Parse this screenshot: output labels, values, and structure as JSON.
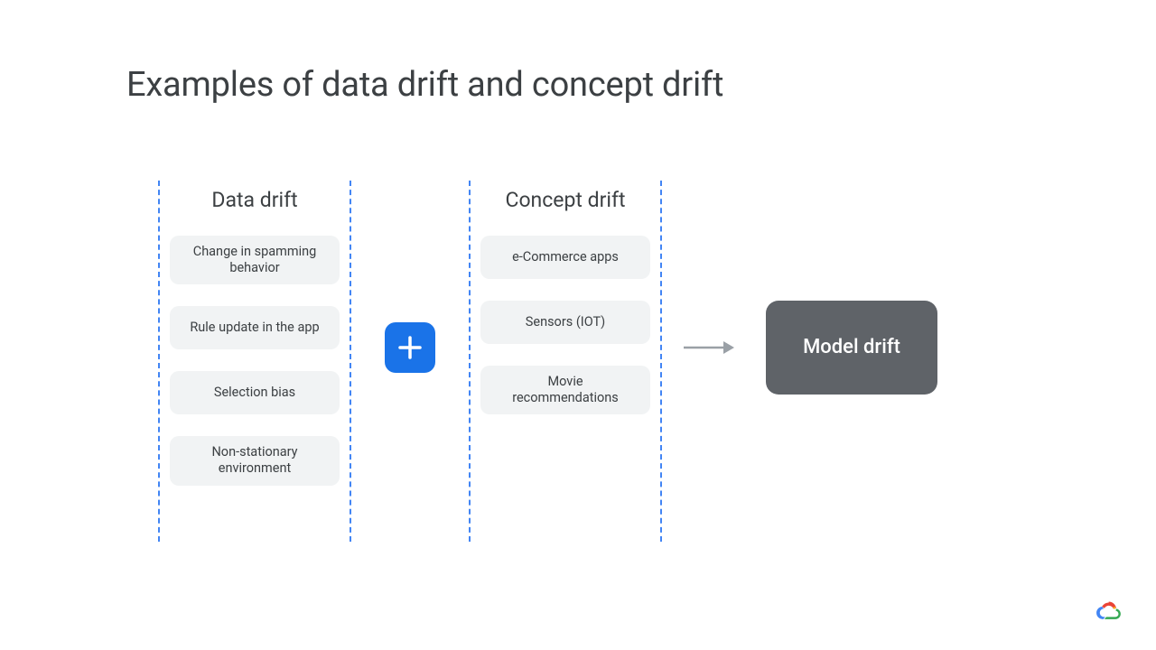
{
  "title": "Examples of data drift and concept drift",
  "columns": {
    "left": {
      "title": "Data drift",
      "items": [
        "Change in spamming behavior",
        "Rule update in the app",
        "Selection bias",
        "Non-stationary environment"
      ]
    },
    "right": {
      "title": "Concept drift",
      "items": [
        "e-Commerce apps",
        "Sensors (IOT)",
        "Movie recommendations"
      ]
    }
  },
  "result": "Model drift"
}
